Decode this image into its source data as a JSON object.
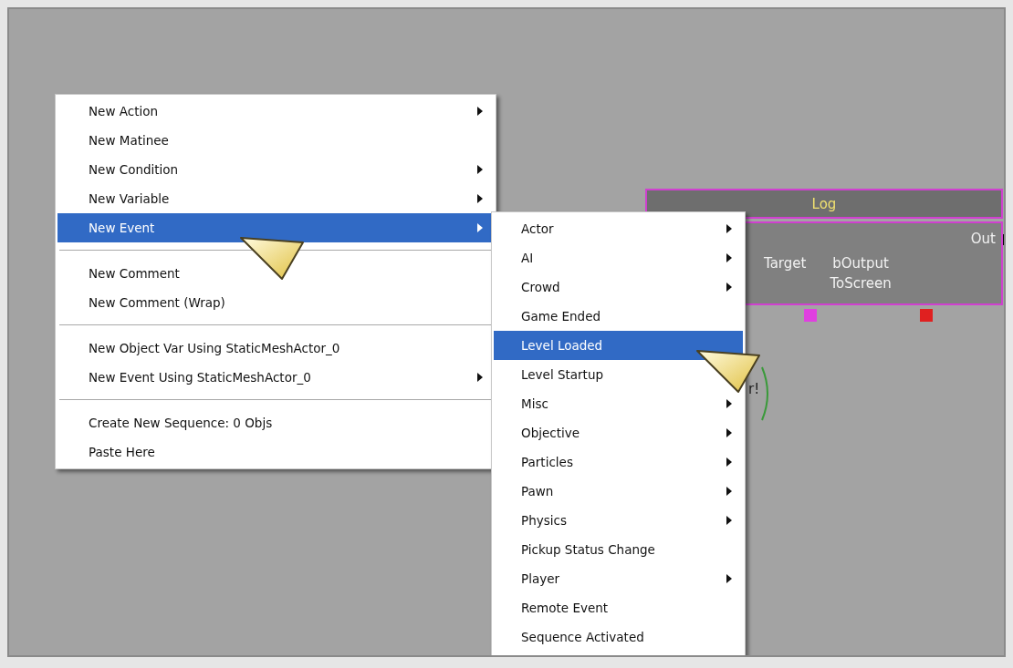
{
  "canvas": {
    "log_node": {
      "title": "Log",
      "output": "Out",
      "inputs": [
        {
          "label": "Target",
          "color": "#e040e0"
        },
        {
          "label": "bOutput ToScreen",
          "color": "#e02020"
        }
      ]
    },
    "partial_label": "r!"
  },
  "context_menu": {
    "groups": [
      [
        {
          "label": "New Action",
          "submenu": true,
          "selected": false
        },
        {
          "label": "New Matinee",
          "submenu": false,
          "selected": false
        },
        {
          "label": "New Condition",
          "submenu": true,
          "selected": false
        },
        {
          "label": "New Variable",
          "submenu": true,
          "selected": false
        },
        {
          "label": "New Event",
          "submenu": true,
          "selected": true
        }
      ],
      [
        {
          "label": "New Comment",
          "submenu": false,
          "selected": false
        },
        {
          "label": "New Comment (Wrap)",
          "submenu": false,
          "selected": false
        }
      ],
      [
        {
          "label": "New Object Var Using StaticMeshActor_0",
          "submenu": false,
          "selected": false
        },
        {
          "label": "New Event Using StaticMeshActor_0",
          "submenu": true,
          "selected": false
        }
      ],
      [
        {
          "label": "Create New Sequence: 0 Objs",
          "submenu": false,
          "selected": false
        },
        {
          "label": "Paste Here",
          "submenu": false,
          "selected": false
        }
      ]
    ]
  },
  "submenu": {
    "items": [
      {
        "label": "Actor",
        "submenu": true,
        "selected": false
      },
      {
        "label": "AI",
        "submenu": true,
        "selected": false
      },
      {
        "label": "Crowd",
        "submenu": true,
        "selected": false
      },
      {
        "label": "Game Ended",
        "submenu": false,
        "selected": false
      },
      {
        "label": "Level Loaded",
        "submenu": false,
        "selected": true
      },
      {
        "label": "Level Startup",
        "submenu": false,
        "selected": false
      },
      {
        "label": "Misc",
        "submenu": true,
        "selected": false
      },
      {
        "label": "Objective",
        "submenu": true,
        "selected": false
      },
      {
        "label": "Particles",
        "submenu": true,
        "selected": false
      },
      {
        "label": "Pawn",
        "submenu": true,
        "selected": false
      },
      {
        "label": "Physics",
        "submenu": true,
        "selected": false
      },
      {
        "label": "Pickup Status Change",
        "submenu": false,
        "selected": false
      },
      {
        "label": "Player",
        "submenu": true,
        "selected": false
      },
      {
        "label": "Remote Event",
        "submenu": false,
        "selected": false
      },
      {
        "label": "Sequence Activated",
        "submenu": false,
        "selected": false
      }
    ]
  }
}
